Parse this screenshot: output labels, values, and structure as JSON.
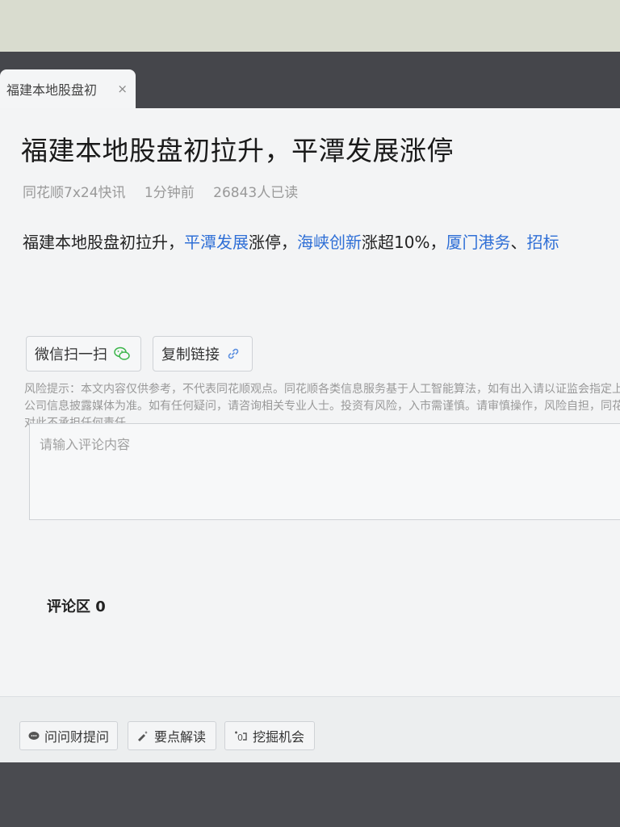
{
  "tab": {
    "title": "福建本地股盘初",
    "close": "×"
  },
  "article": {
    "headline": "福建本地股盘初拉升，平潭发展涨停",
    "meta": {
      "source": "同花顺7x24快讯",
      "time": "1分钟前",
      "reads": "26843人已读"
    },
    "body": {
      "p1": "福建本地股盘初拉升，",
      "link1": "平潭发展",
      "p2": "涨停，",
      "link2": "海峡创新",
      "p3": "涨超10%，",
      "link3": "厦门港务",
      "p4": "、",
      "link4": "招标"
    }
  },
  "share": {
    "wechat_label": "微信扫一扫",
    "copy_label": "复制链接"
  },
  "risk_notice": "风险提示：本文内容仅供参考，不代表同花顺观点。同花顺各类信息服务基于人工智能算法，如有出入请以证监会指定上市公司信息披露媒体为准。如有任何疑问，请咨询相关专业人士。投资有风险，入市需谨慎。请审慎操作，风险自担，同花顺对此不承担任何责任。",
  "comment": {
    "placeholder": "请输入评论内容"
  },
  "comments_section": {
    "title": "评论区 0"
  },
  "footer": {
    "ask_label": "问问财提问",
    "keypoints_label": "要点解读",
    "dig_label": "挖掘机会"
  },
  "colors": {
    "link": "#2f6fd6",
    "page_bg": "#f3f4f5",
    "tab_bar": "#45464b"
  }
}
